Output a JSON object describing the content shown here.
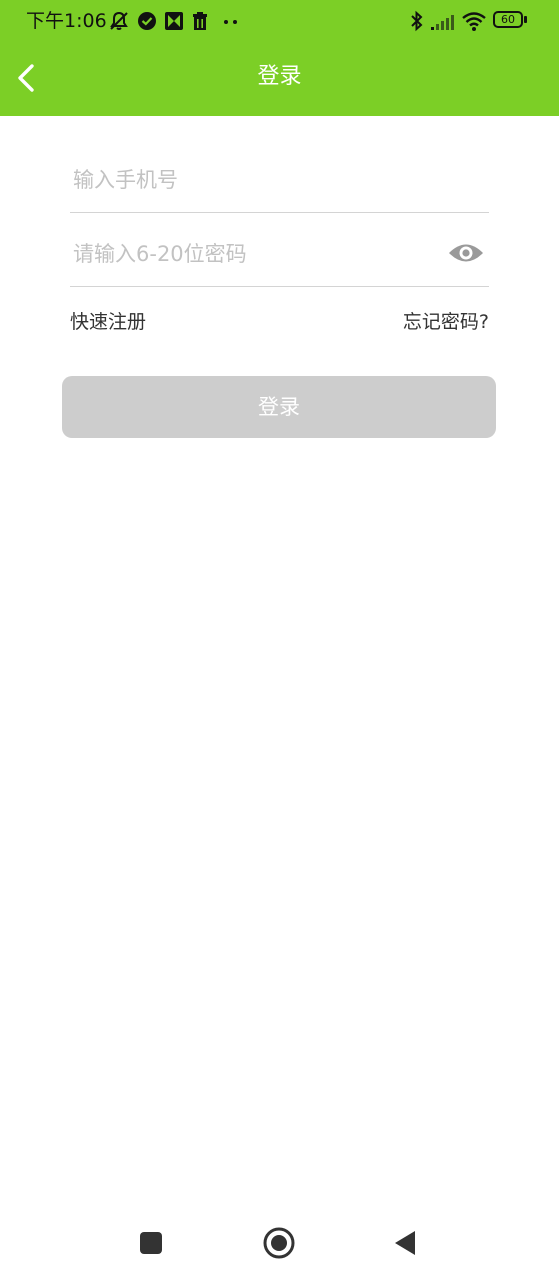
{
  "status_bar": {
    "time": "下午1:06",
    "battery": "60",
    "icons": [
      "mute-icon",
      "check-circle-icon",
      "app-icon",
      "trash-icon",
      "more-dots-icon",
      "bluetooth-icon",
      "signal-icon",
      "wifi-icon",
      "battery-icon"
    ]
  },
  "header": {
    "title": "登录",
    "background": "#7ccf26"
  },
  "form": {
    "phone_placeholder": "输入手机号",
    "password_placeholder": "请输入6-20位密码",
    "register_link": "快速注册",
    "forgot_link": "忘记密码?",
    "login_button": "登录"
  },
  "nav_bar": {
    "items": [
      "recents-button",
      "home-button",
      "back-button"
    ]
  }
}
